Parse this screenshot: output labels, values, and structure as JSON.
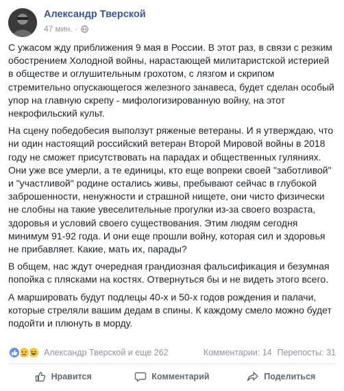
{
  "post": {
    "author": "Александр Тверской",
    "time": "47 мин.",
    "separator": "·",
    "paragraphs": [
      "С ужасом жду приближения 9 мая в России. В этот раз, в связи с резким обострением Холодной войны, нарастающей милитаристской истерией в обществе и оглушительным грохотом, с лязгом и скрипом стремительно опускающегося железного занавеса, будет сделан особый упор на главную скрепу - мифологизированную войну, на этот некрофильский культ.",
      "На сцену победобесия выползут ряженые ветераны. И я утверждаю, что ни один настоящий российский ветеран Второй Мировой войны в 2018 году не сможет присутствовать на парадах и общественных гуляниях. Они уже все умерли, а те единицы, кто еще вопреки своей \"заботливой\" и \"участливой\" родине остались живы, пребывают сейчас в глубокой заброшенности, ненужности и страшной нищете, они чисто физически не слобны на такие увеселительные прогулки из-за своего возраста, здоровья и условий своего существования. Этим людям сегодня минимум 91-92 года. И они еще прошли войну, которая сил и здоровья не прибавляет. Какие, мать их, парады?",
      "В общем, нас ждут очередная грандиозная фальсификация и безумная попойка с плясками на костях. Отвернуться бы и не видеть этого всего.",
      "А маршировать будут подлецы 40-х и 50-х годов рождения и палачи, которые стреляли вашим дедам в спины. К каждому смело можно будет подойти и плюнуть в морду."
    ]
  },
  "stats": {
    "reactors": "Александр Тверской и еще 262",
    "comments": "Комментарии: 14",
    "shares": "Перепосты: 31",
    "reaction_icons": [
      "like-icon",
      "sad-icon",
      "haha-icon"
    ]
  },
  "actions": {
    "like": "Нравится",
    "comment": "Комментарий",
    "share": "Поделиться"
  },
  "colors": {
    "author": "#365899",
    "meta": "#90949c",
    "text": "#1d2129",
    "action": "#606770"
  }
}
